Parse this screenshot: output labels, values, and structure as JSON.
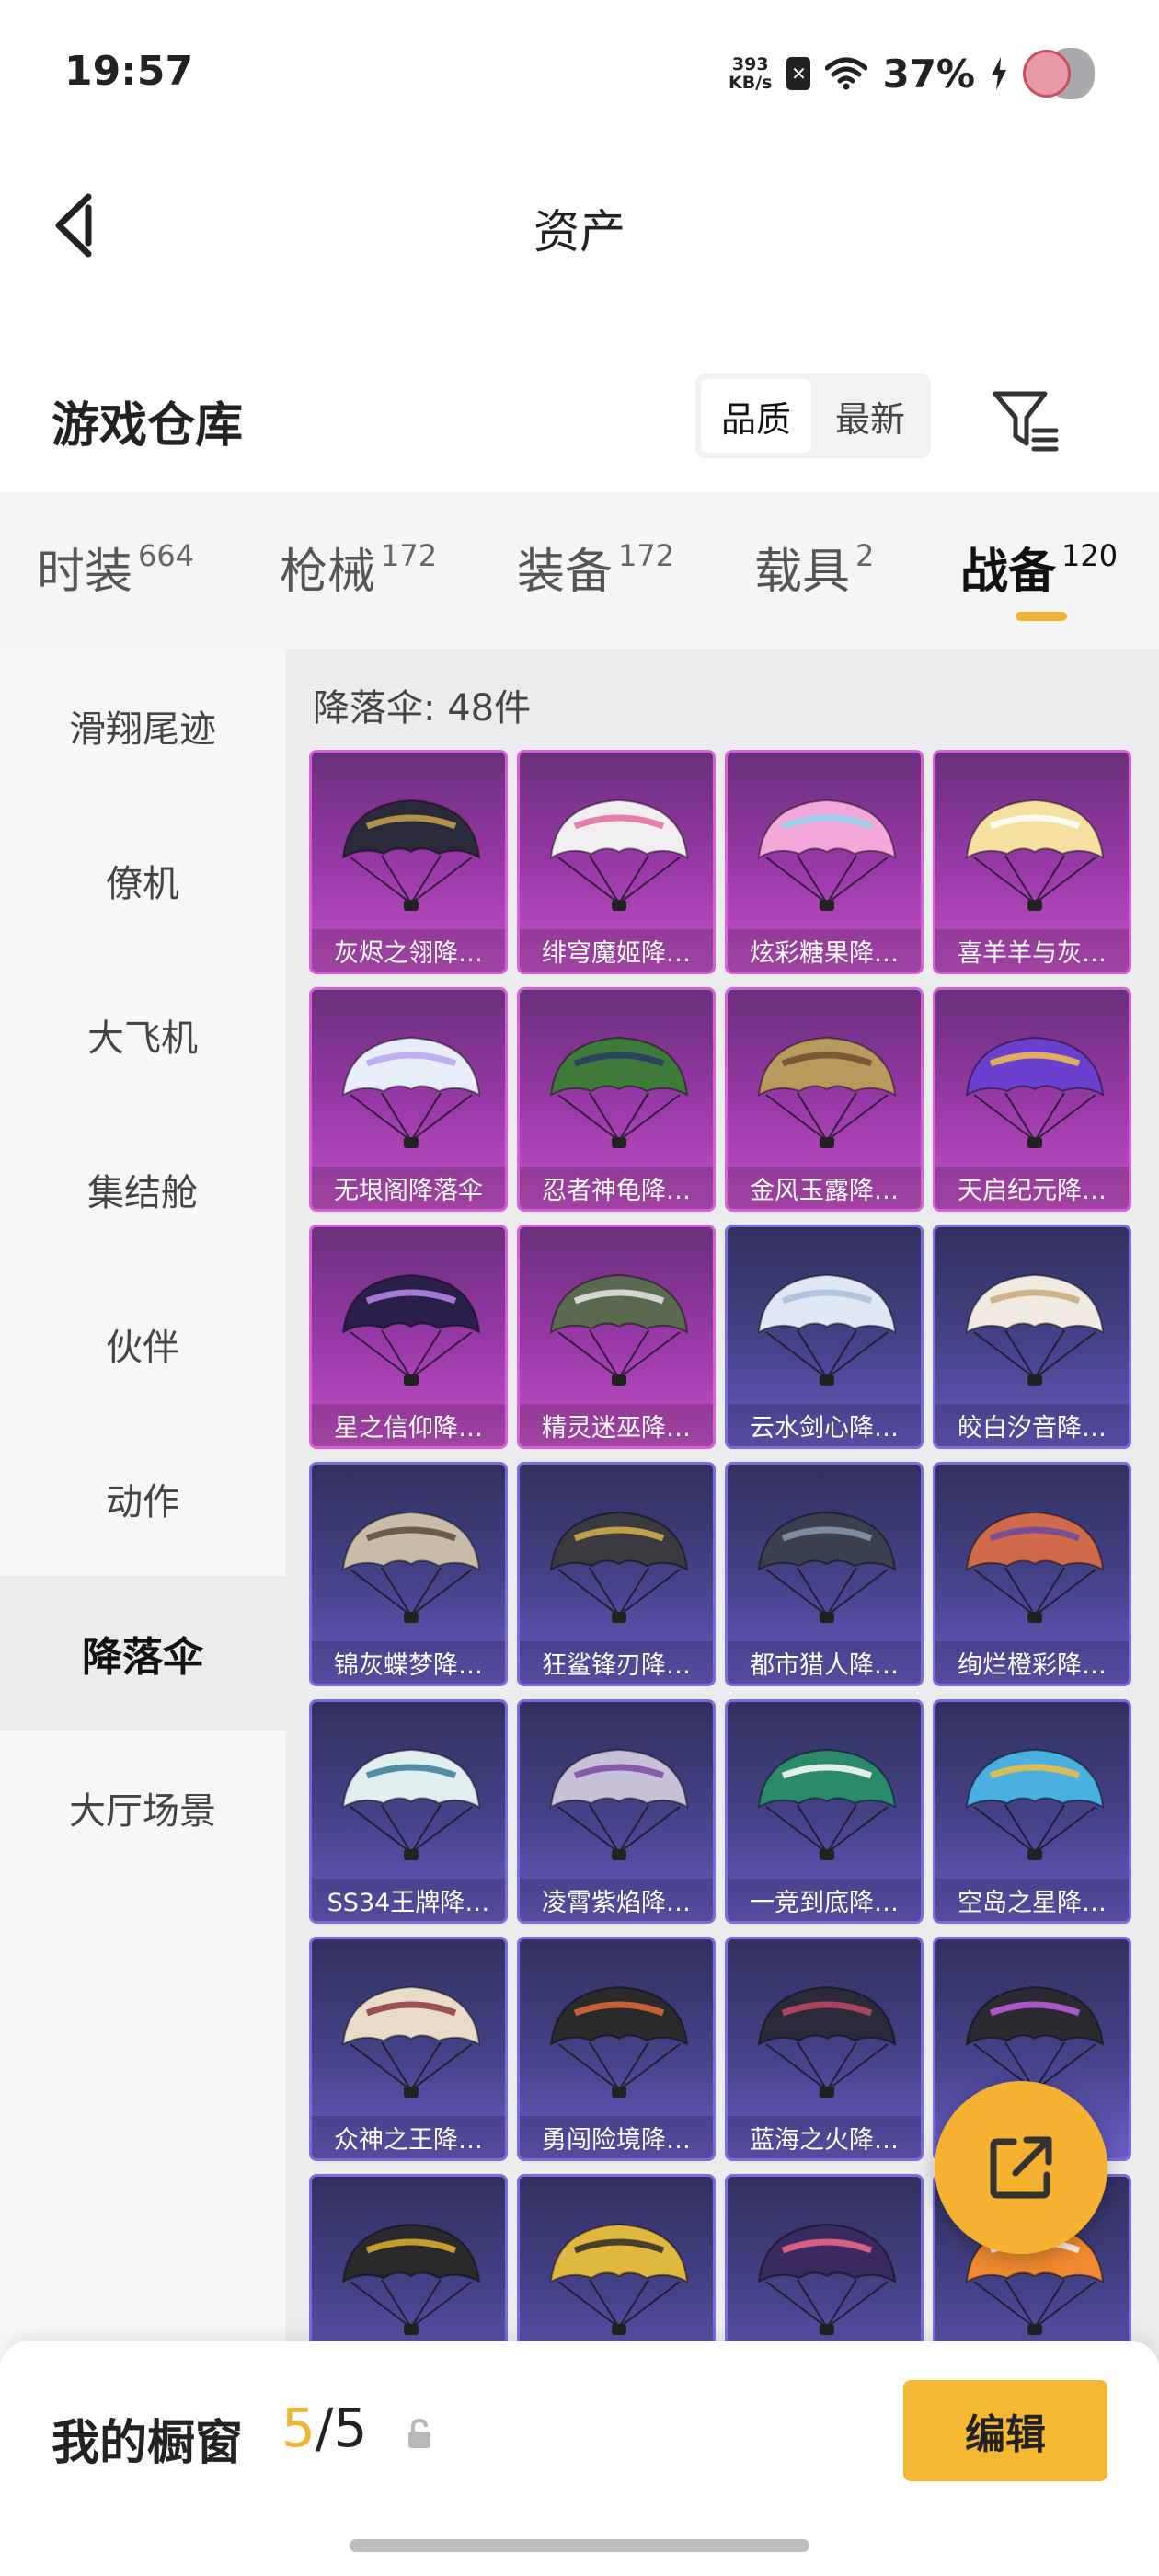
{
  "status_bar": {
    "time": "19:57",
    "net_speed_value": "393",
    "net_speed_unit": "KB/s",
    "battery": "37%"
  },
  "header": {
    "title": "资产"
  },
  "warehouse": {
    "title": "游戏仓库",
    "sort_options": [
      "品质",
      "最新"
    ],
    "sort_active": "品质"
  },
  "tabs": [
    {
      "label": "时装",
      "count": "664"
    },
    {
      "label": "枪械",
      "count": "172"
    },
    {
      "label": "装备",
      "count": "172"
    },
    {
      "label": "载具",
      "count": "2"
    },
    {
      "label": "战备",
      "count": "120"
    }
  ],
  "sidebar": {
    "items": [
      "滑翔尾迹",
      "僚机",
      "大飞机",
      "集结舱",
      "伙伴",
      "动作",
      "降落伞",
      "大厅场景"
    ],
    "active": "降落伞"
  },
  "content": {
    "count_label": "降落伞: 48件",
    "items": [
      {
        "name": "灰烬之翎降…",
        "rarity": "purple",
        "color": "#2b2a3a",
        "accent": "#c9a24a"
      },
      {
        "name": "绯穹魔姬降…",
        "rarity": "purple",
        "color": "#f0eef0",
        "accent": "#e06aa0"
      },
      {
        "name": "炫彩糖果降…",
        "rarity": "purple",
        "color": "#f2a8d8",
        "accent": "#8fd8f0"
      },
      {
        "name": "喜羊羊与灰…",
        "rarity": "purple",
        "color": "#f4e1a0",
        "accent": "#ffffff"
      },
      {
        "name": "无垠阁降落伞",
        "rarity": "purple",
        "color": "#e8eef8",
        "accent": "#b7a2f0"
      },
      {
        "name": "忍者神龟降…",
        "rarity": "purple",
        "color": "#3f7a3a",
        "accent": "#2a3a6a"
      },
      {
        "name": "金风玉露降…",
        "rarity": "purple",
        "color": "#b89a5e",
        "accent": "#6a4f2a"
      },
      {
        "name": "天启纪元降…",
        "rarity": "purple",
        "color": "#6a40d0",
        "accent": "#f5c14a"
      },
      {
        "name": "星之信仰降…",
        "rarity": "purple",
        "color": "#2a1e4a",
        "accent": "#b88af0"
      },
      {
        "name": "精灵迷巫降…",
        "rarity": "purple",
        "color": "#5a6a4e",
        "accent": "#e8e8e8"
      },
      {
        "name": "云水剑心降…",
        "rarity": "blue",
        "color": "#dde8f2",
        "accent": "#a8c0d8"
      },
      {
        "name": "皎白汐音降…",
        "rarity": "blue",
        "color": "#f0eae0",
        "accent": "#c8a878"
      },
      {
        "name": "锦灰蝶梦降…",
        "rarity": "blue",
        "color": "#c8bca8",
        "accent": "#5a4a3a"
      },
      {
        "name": "狂鲨锋刃降…",
        "rarity": "blue",
        "color": "#3a3a40",
        "accent": "#d8b24a"
      },
      {
        "name": "都市猎人降…",
        "rarity": "blue",
        "color": "#3a4050",
        "accent": "#8a9ab0"
      },
      {
        "name": "绚烂橙彩降…",
        "rarity": "blue",
        "color": "#d06a4a",
        "accent": "#6a4aa0"
      },
      {
        "name": "SS34王牌降…",
        "rarity": "blue",
        "color": "#e0eef0",
        "accent": "#3a7a9a"
      },
      {
        "name": "凌霄紫焰降…",
        "rarity": "blue",
        "color": "#c8c0d8",
        "accent": "#7a4aa0"
      },
      {
        "name": "一竞到底降…",
        "rarity": "blue",
        "color": "#2a8a6a",
        "accent": "#ffffff"
      },
      {
        "name": "空岛之星降…",
        "rarity": "blue",
        "color": "#4ab0e0",
        "accent": "#f0c040"
      },
      {
        "name": "众神之王降…",
        "rarity": "blue",
        "color": "#e8dcc8",
        "accent": "#8a3a3a"
      },
      {
        "name": "勇闯险境降…",
        "rarity": "blue",
        "color": "#2a2a2a",
        "accent": "#e06a3a"
      },
      {
        "name": "蓝海之火降…",
        "rarity": "blue",
        "color": "#2a2a3a",
        "accent": "#c04a6a"
      },
      {
        "name": "",
        "rarity": "blue",
        "color": "#2a2a30",
        "accent": "#c060e0"
      },
      {
        "name": "",
        "rarity": "blue",
        "color": "#2a2a2a",
        "accent": "#e0b030"
      },
      {
        "name": "",
        "rarity": "blue",
        "color": "#e0b840",
        "accent": "#2a2a2a"
      },
      {
        "name": "",
        "rarity": "blue",
        "color": "#3a2a60",
        "accent": "#f06a8a"
      },
      {
        "name": "",
        "rarity": "blue",
        "color": "#f08a30",
        "accent": "#ffffff"
      }
    ]
  },
  "showcase": {
    "title": "我的橱窗",
    "current": "5",
    "total": "/5",
    "edit_label": "编辑"
  }
}
